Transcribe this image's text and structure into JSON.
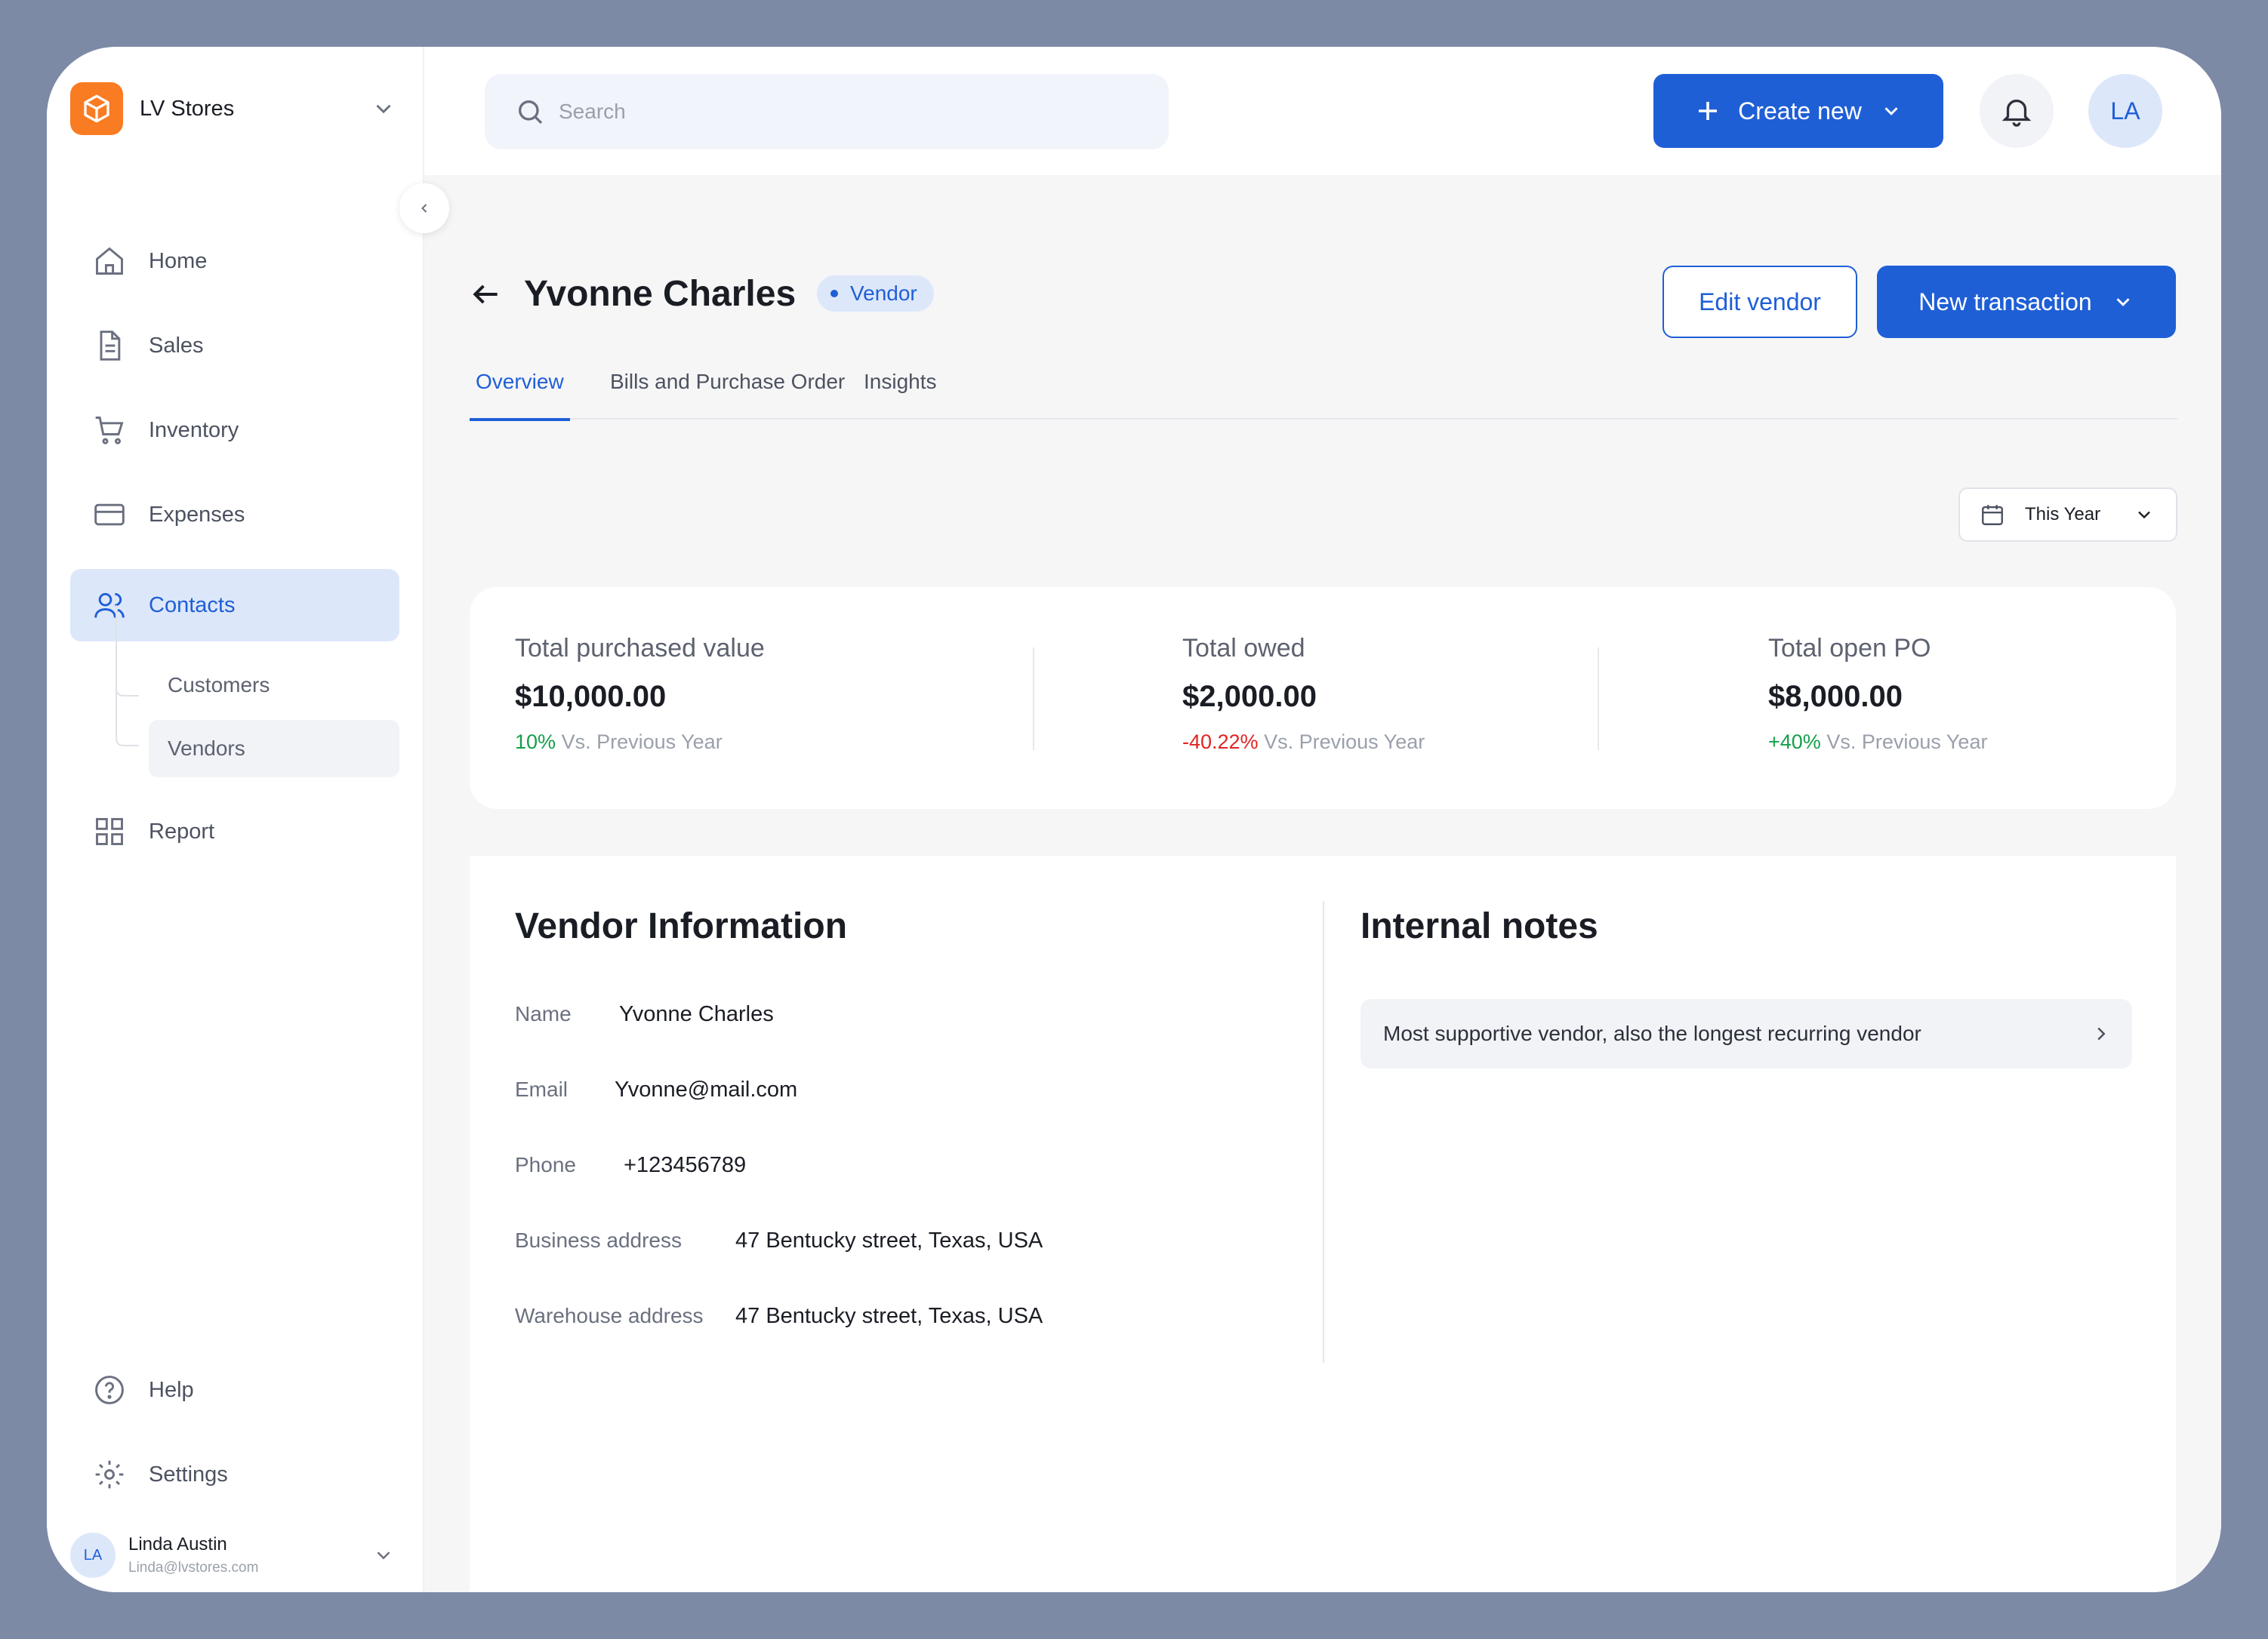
{
  "store": {
    "name": "LV Stores",
    "logo_icon": "box-icon",
    "brand_color": "#f97b22"
  },
  "nav": {
    "items": [
      {
        "label": "Home",
        "icon": "home-icon"
      },
      {
        "label": "Sales",
        "icon": "document-icon"
      },
      {
        "label": "Inventory",
        "icon": "cart-icon"
      },
      {
        "label": "Expenses",
        "icon": "credit-card-icon"
      },
      {
        "label": "Contacts",
        "icon": "users-icon",
        "active": true
      },
      {
        "label": "Report",
        "icon": "grid-icon"
      },
      {
        "label": "Help",
        "icon": "help-icon"
      },
      {
        "label": "Settings",
        "icon": "gear-icon"
      }
    ],
    "contacts_sub": [
      {
        "label": "Customers"
      },
      {
        "label": "Vendors",
        "active": true
      }
    ]
  },
  "user": {
    "initials": "LA",
    "name": "Linda Austin",
    "email": "Linda@lvstores.com"
  },
  "topbar": {
    "search_placeholder": "Search",
    "create_label": "Create new",
    "avatar_initials": "LA",
    "accent_color": "#1f5fd6"
  },
  "page": {
    "title": "Yvonne Charles",
    "badge": "Vendor",
    "edit_label": "Edit vendor",
    "new_tx_label": "New transaction",
    "tabs": [
      {
        "label": "Overview",
        "active": true
      },
      {
        "label": "Bills and Purchase Order"
      },
      {
        "label": "Insights"
      }
    ],
    "range": "This Year"
  },
  "stats": [
    {
      "label": "Total purchased value",
      "value": "$10,000.00",
      "delta": "10%",
      "trend": "up",
      "suffix": "Vs. Previous Year"
    },
    {
      "label": "Total owed",
      "value": "$2,000.00",
      "delta": "-40.22%",
      "trend": "down",
      "suffix": "Vs. Previous Year"
    },
    {
      "label": "Total open PO",
      "value": "$8,000.00",
      "delta": "+40%",
      "trend": "up",
      "suffix": "Vs. Previous Year"
    }
  ],
  "vendor_info": {
    "title": "Vendor Information",
    "fields": [
      {
        "label": "Name",
        "value": "Yvonne Charles"
      },
      {
        "label": "Email",
        "value": "Yvonne@mail.com"
      },
      {
        "label": "Phone",
        "value": "+123456789"
      },
      {
        "label": "Business address",
        "value": "47 Bentucky street, Texas, USA"
      },
      {
        "label": "Warehouse address",
        "value": "47 Bentucky street, Texas, USA"
      }
    ]
  },
  "notes": {
    "title": "Internal notes",
    "items": [
      {
        "text": "Most supportive vendor, also the longest recurring vendor"
      }
    ]
  }
}
